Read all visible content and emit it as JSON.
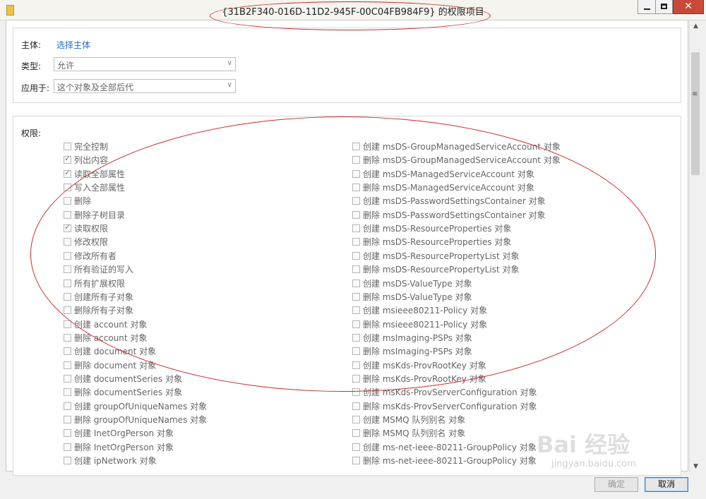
{
  "window": {
    "title": "{31B2F340-016D-11D2-945F-00C04FB984F9} 的权限项目",
    "close_glyph": "✕"
  },
  "principal": {
    "label": "主体:",
    "link": "选择主体"
  },
  "type": {
    "label": "类型:",
    "value": "允许"
  },
  "applies_to": {
    "label": "应用于:",
    "value": "这个对象及全部后代"
  },
  "permissions": {
    "label": "权限:",
    "left": [
      {
        "label": "完全控制",
        "checked": false
      },
      {
        "label": "列出内容",
        "checked": true
      },
      {
        "label": "读取全部属性",
        "checked": true
      },
      {
        "label": "写入全部属性",
        "checked": false
      },
      {
        "label": "删除",
        "checked": false
      },
      {
        "label": "删除子树目录",
        "checked": false
      },
      {
        "label": "读取权限",
        "checked": true
      },
      {
        "label": "修改权限",
        "checked": false
      },
      {
        "label": "修改所有者",
        "checked": false
      },
      {
        "label": "所有验证的写入",
        "checked": false
      },
      {
        "label": "所有扩展权限",
        "checked": false
      },
      {
        "label": "创建所有子对象",
        "checked": false
      },
      {
        "label": "删除所有子对象",
        "checked": false
      },
      {
        "label": "创建 account 对象",
        "checked": false
      },
      {
        "label": "删除 account 对象",
        "checked": false
      },
      {
        "label": "创建 document 对象",
        "checked": false
      },
      {
        "label": "删除 document 对象",
        "checked": false
      },
      {
        "label": "创建 documentSeries 对象",
        "checked": false
      },
      {
        "label": "删除 documentSeries 对象",
        "checked": false
      },
      {
        "label": "创建 groupOfUniqueNames 对象",
        "checked": false
      },
      {
        "label": "删除 groupOfUniqueNames 对象",
        "checked": false
      },
      {
        "label": "创建 InetOrgPerson 对象",
        "checked": false
      },
      {
        "label": "删除 InetOrgPerson 对象",
        "checked": false
      },
      {
        "label": "创建 ipNetwork 对象",
        "checked": false
      }
    ],
    "right": [
      {
        "label": "创建 msDS-GroupManagedServiceAccount 对象",
        "checked": false
      },
      {
        "label": "删除 msDS-GroupManagedServiceAccount 对象",
        "checked": false
      },
      {
        "label": "创建 msDS-ManagedServiceAccount 对象",
        "checked": false
      },
      {
        "label": "删除 msDS-ManagedServiceAccount 对象",
        "checked": false
      },
      {
        "label": "创建 msDS-PasswordSettingsContainer 对象",
        "checked": false
      },
      {
        "label": "删除 msDS-PasswordSettingsContainer 对象",
        "checked": false
      },
      {
        "label": "创建 msDS-ResourceProperties 对象",
        "checked": false
      },
      {
        "label": "删除 msDS-ResourceProperties 对象",
        "checked": false
      },
      {
        "label": "创建 msDS-ResourcePropertyList 对象",
        "checked": false
      },
      {
        "label": "删除 msDS-ResourcePropertyList 对象",
        "checked": false
      },
      {
        "label": "创建 msDS-ValueType 对象",
        "checked": false
      },
      {
        "label": "删除 msDS-ValueType 对象",
        "checked": false
      },
      {
        "label": "创建 msieee80211-Policy 对象",
        "checked": false
      },
      {
        "label": "删除 msieee80211-Policy 对象",
        "checked": false
      },
      {
        "label": "创建 msImaging-PSPs 对象",
        "checked": false
      },
      {
        "label": "删除 msImaging-PSPs 对象",
        "checked": false
      },
      {
        "label": "创建 msKds-ProvRootKey 对象",
        "checked": false
      },
      {
        "label": "删除 msKds-ProvRootKey 对象",
        "checked": false
      },
      {
        "label": "创建 msKds-ProvServerConfiguration 对象",
        "checked": false
      },
      {
        "label": "删除 msKds-ProvServerConfiguration 对象",
        "checked": false
      },
      {
        "label": "创建 MSMQ 队列别名 对象",
        "checked": false
      },
      {
        "label": "删除 MSMQ 队列别名 对象",
        "checked": false
      },
      {
        "label": "创建 ms-net-ieee-80211-GroupPolicy 对象",
        "checked": false
      },
      {
        "label": "删除 ms-net-ieee-80211-GroupPolicy 对象",
        "checked": false
      }
    ]
  },
  "buttons": {
    "ok": "确定",
    "cancel": "取消"
  },
  "watermark": {
    "brand": "Bai 经验",
    "url": "jingyan.baidu.com"
  }
}
